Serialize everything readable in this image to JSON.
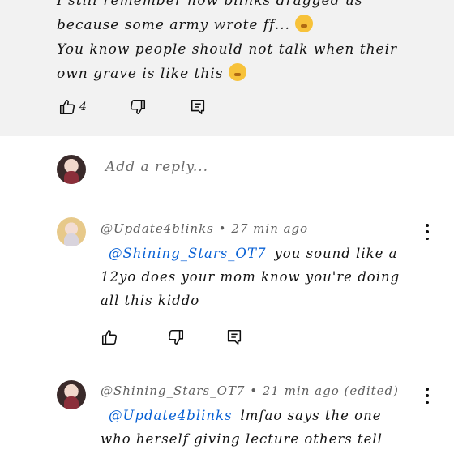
{
  "top_comment": {
    "lines": [
      "I still remember how blinks dragged us",
      "because some army wrote ff...",
      "You know people should not talk when their",
      "own grave is like this"
    ],
    "like_count": "4"
  },
  "composer": {
    "placeholder": "Add a reply..."
  },
  "comments": [
    {
      "author": "@Update4blinks",
      "separator": "•",
      "time": "27 min ago",
      "mention": "@Shining_Stars_OT7",
      "text_lines": [
        "you sound like a",
        "12yo does your mom know you're doing",
        "all this kiddo"
      ]
    },
    {
      "author": "@Shining_Stars_OT7",
      "separator": "•",
      "time": "21 min ago (edited)",
      "mention": "@Update4blinks",
      "text_lines": [
        "lmfao says the one",
        "who herself giving lecture others tell"
      ]
    }
  ],
  "icons": {
    "like": "thumbs-up-icon",
    "dislike": "thumbs-down-icon",
    "reply": "comment-reply-icon",
    "more": "more-vert-icon",
    "emoji1": "shushing-face-emoji",
    "emoji2": "astonished-face-emoji"
  }
}
